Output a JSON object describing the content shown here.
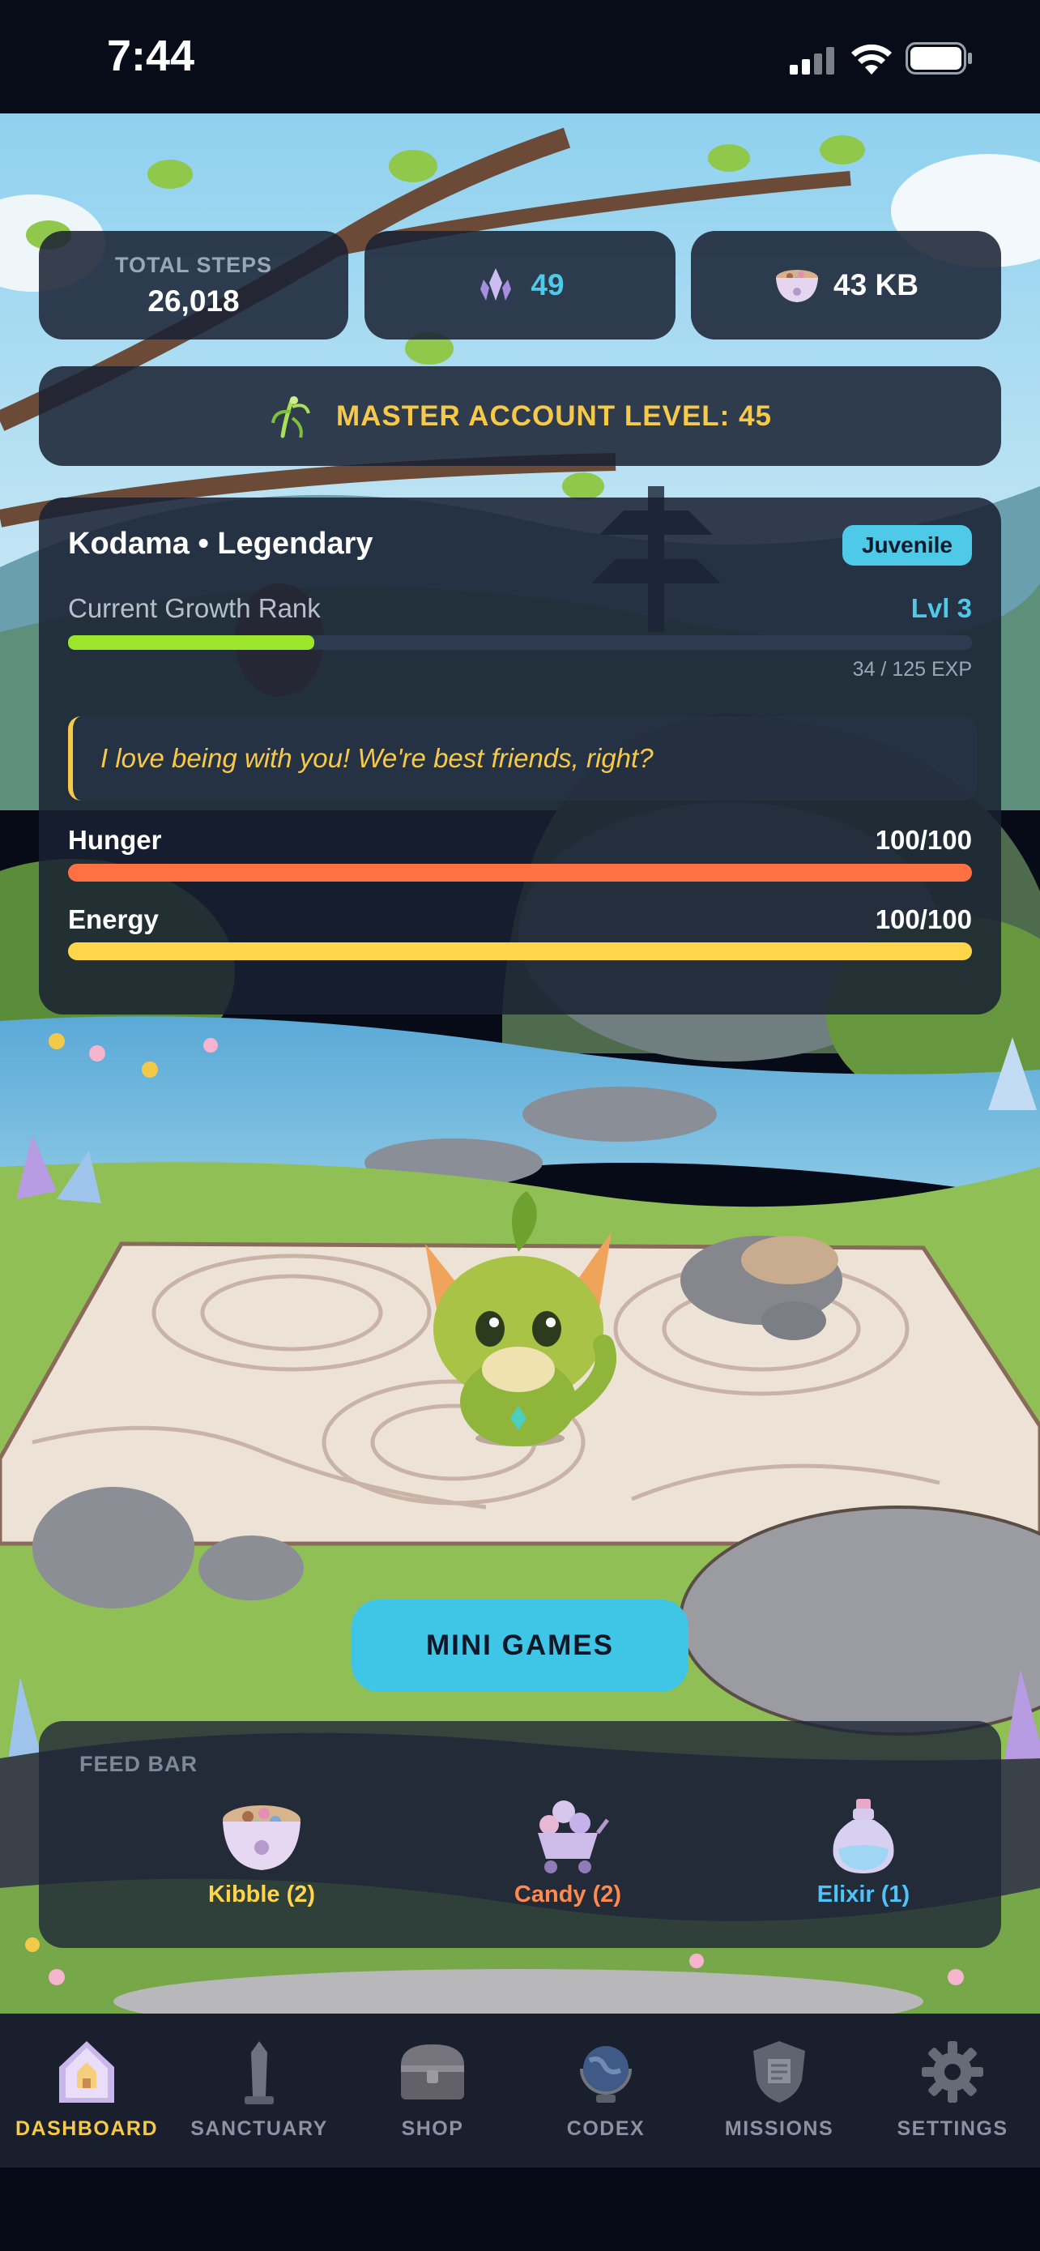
{
  "status_bar": {
    "time": "7:44"
  },
  "stats": {
    "total_steps_label": "TOTAL STEPS",
    "total_steps_value": "26,018",
    "crystals": "49",
    "storage": "43 KB"
  },
  "master_level": "MASTER ACCOUNT LEVEL: 45",
  "pet": {
    "title": "Kodama • Legendary",
    "stage_badge": "Juvenile",
    "rank_label": "Current Growth Rank",
    "rank_level": "Lvl 3",
    "exp_text": "34 / 125 EXP",
    "exp_progress": 0.272,
    "quote": "I love being with you! We're best friends, right?",
    "stats": [
      {
        "label": "Hunger",
        "value": "100/100",
        "progress": 1.0,
        "color": "#ff7043"
      },
      {
        "label": "Energy",
        "value": "100/100",
        "progress": 1.0,
        "color": "#ffd54a"
      }
    ]
  },
  "mini_games_label": "MINI GAMES",
  "feed_bar": {
    "label": "FEED BAR",
    "items": [
      {
        "label": "Kibble (2)",
        "color": "#ffd54a",
        "icon": "kibble-bowl-icon"
      },
      {
        "label": "Candy (2)",
        "color": "#ff8a50",
        "icon": "candy-cart-icon"
      },
      {
        "label": "Elixir (1)",
        "color": "#4fc3f7",
        "icon": "elixir-bottle-icon"
      }
    ]
  },
  "nav": {
    "items": [
      {
        "label": "DASHBOARD",
        "active": true,
        "icon": "home-icon"
      },
      {
        "label": "SANCTUARY",
        "active": false,
        "icon": "obelisk-icon"
      },
      {
        "label": "SHOP",
        "active": false,
        "icon": "chest-icon"
      },
      {
        "label": "CODEX",
        "active": false,
        "icon": "globe-icon"
      },
      {
        "label": "MISSIONS",
        "active": false,
        "icon": "shield-icon"
      },
      {
        "label": "SETTINGS",
        "active": false,
        "icon": "gear-icon"
      }
    ]
  },
  "colors": {
    "accent_gold": "#f7c948",
    "accent_cyan": "#4ec9e8",
    "exp_green": "#9be52b",
    "active_nav": "#f7c948"
  }
}
